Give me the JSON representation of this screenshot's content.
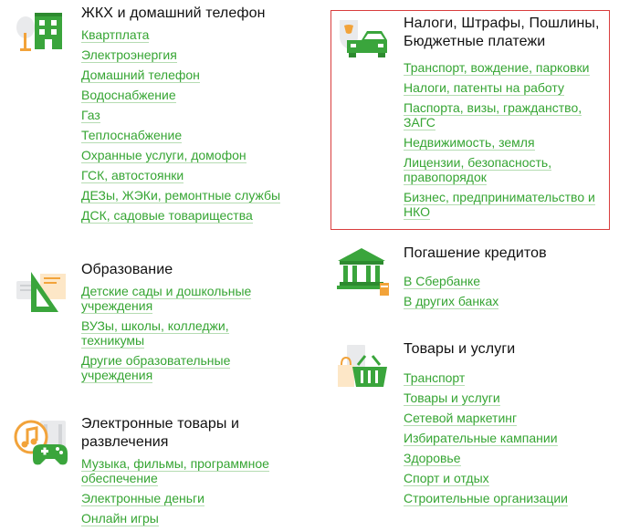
{
  "colors": {
    "link": "#36a533",
    "link_underline": "#b5dcb2",
    "heading": "#111111",
    "highlight_frame": "#d93d3d",
    "icon_green": "#3aa53c",
    "icon_orange": "#f2a33a"
  },
  "left": [
    {
      "title": "ЖКХ и домашний телефон",
      "icon": "building-tree-icon",
      "links": [
        "Квартплата",
        "Электроэнергия",
        "Домашний телефон",
        "Водоснабжение",
        "Газ",
        "Теплоснабжение",
        "Охранные услуги, домофон",
        "ГСК, автостоянки",
        "ДЕЗы, ЖЭКи, ремонтные службы",
        "ДСК, садовые товарищества"
      ]
    },
    {
      "title": "Образование",
      "icon": "triangle-ruler-icon",
      "links": [
        "Детские сады и дошкольные учреждения",
        "ВУЗы, школы, колледжи, техникумы",
        "Другие образовательные учреждения"
      ]
    },
    {
      "title": "Электронные товары и развлечения",
      "icon": "music-gamepad-icon",
      "links": [
        "Музыка, фильмы, программное обеспечение",
        "Электронные деньги",
        "Онлайн игры"
      ]
    }
  ],
  "right": [
    {
      "title": "Налоги, Штрафы, Пошлины, Бюджетные платежи",
      "icon": "emblem-car-icon",
      "links": [
        "Транспорт, вождение, парковки",
        "Налоги, патенты на работу",
        "Паспорта, визы, гражданство, ЗАГС",
        "Недвижимость, земля",
        "Лицензии, безопасность, правопорядок",
        "Бизнес, предпринимательство и НКО"
      ]
    },
    {
      "title": "Погашение кредитов",
      "icon": "bank-building-icon",
      "links": [
        "В Сбербанке",
        "В других банках"
      ]
    },
    {
      "title": "Товары и услуги",
      "icon": "shopping-basket-icon",
      "links": [
        "Транспорт",
        "Товары и услуги",
        "Сетевой маркетинг",
        "Избирательные кампании",
        "Здоровье",
        "Спорт и отдых",
        "Строительные организации"
      ]
    }
  ]
}
